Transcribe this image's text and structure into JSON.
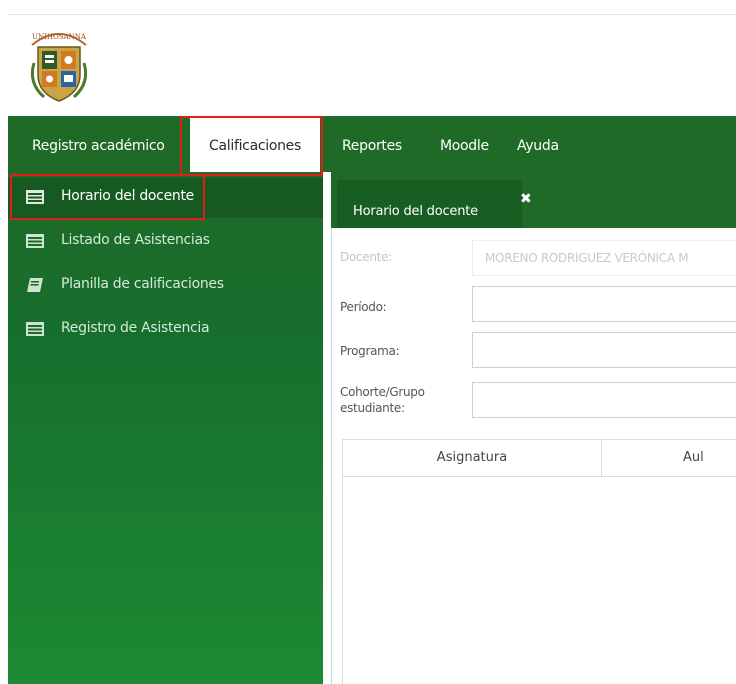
{
  "logo": {
    "text": "UNIHOSANNA"
  },
  "navbar": {
    "items": [
      {
        "label": "Registro académico"
      },
      {
        "label": "Calificaciones"
      },
      {
        "label": "Reportes"
      },
      {
        "label": "Moodle"
      },
      {
        "label": "Ayuda"
      }
    ]
  },
  "sidebar": {
    "items": [
      {
        "label": "Horario del docente",
        "icon": "list-icon"
      },
      {
        "label": "Listado de Asistencias",
        "icon": "list-icon"
      },
      {
        "label": "Planilla de calificaciones",
        "icon": "book-icon"
      },
      {
        "label": "Registro de Asistencia",
        "icon": "list-icon"
      }
    ]
  },
  "content": {
    "tab_label": "Horario del docente",
    "tab_close": "✖",
    "form": {
      "docente_label": "Docente:",
      "docente_value": "MORENO RODRIGUEZ VERÓNICA M",
      "periodo_label": "Período:",
      "programa_label": "Programa:",
      "cohorte_label_1": "Cohorte/Grupo",
      "cohorte_label_2": "estudiante:"
    },
    "table": {
      "columns": [
        "Asignatura",
        "Aul"
      ]
    }
  },
  "colors": {
    "primary_green": "#1f6a26",
    "highlight_red": "#e31b1b"
  }
}
